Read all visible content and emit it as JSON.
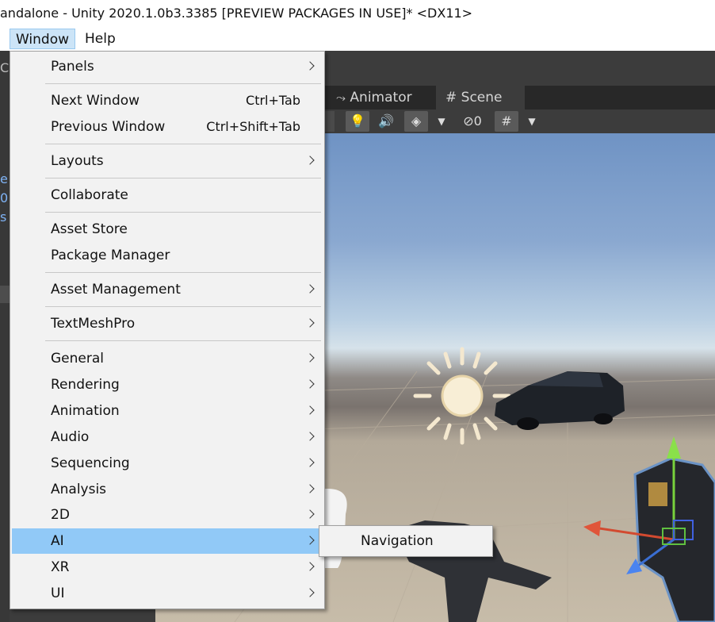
{
  "window": {
    "title": "andalone - Unity 2020.1.0b3.3385 [PREVIEW PACKAGES IN USE]* <DX11>"
  },
  "menubar": {
    "items": [
      "Window",
      "Help"
    ]
  },
  "left_panel": {
    "fragments": [
      "e",
      "0",
      "s"
    ],
    "top_fragment": "C"
  },
  "tabs": {
    "animator": "Animator",
    "scene": "Scene"
  },
  "toolbar": {
    "hidden_count": "0"
  },
  "window_menu": {
    "panels": "Panels",
    "next_window": "Next Window",
    "next_window_shortcut": "Ctrl+Tab",
    "previous_window": "Previous Window",
    "previous_window_shortcut": "Ctrl+Shift+Tab",
    "layouts": "Layouts",
    "collaborate": "Collaborate",
    "asset_store": "Asset Store",
    "package_manager": "Package Manager",
    "asset_management": "Asset Management",
    "textmeshpro": "TextMeshPro",
    "general": "General",
    "rendering": "Rendering",
    "animation": "Animation",
    "audio": "Audio",
    "sequencing": "Sequencing",
    "analysis": "Analysis",
    "two_d": "2D",
    "ai": "AI",
    "xr": "XR",
    "ui": "UI"
  },
  "ai_submenu": {
    "navigation": "Navigation"
  },
  "colors": {
    "highlight": "#91c9f7",
    "menu_bg": "#f2f2f2",
    "editor_bg": "#3c3c3c"
  }
}
